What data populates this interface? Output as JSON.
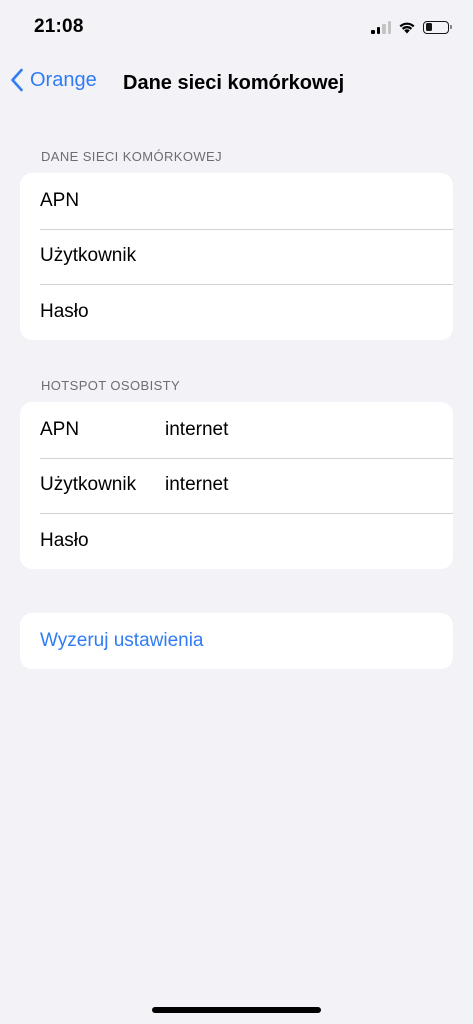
{
  "status_bar": {
    "time": "21:08",
    "icons": [
      "signal-icon",
      "wifi-icon",
      "battery-icon"
    ],
    "battery_level": 0.3
  },
  "nav": {
    "back_label": "Orange",
    "title": "Dane sieci komórkowej"
  },
  "sections": {
    "cellular": {
      "header": "DANE SIECI KOMÓRKOWEJ",
      "rows": [
        {
          "label": "APN",
          "value": ""
        },
        {
          "label": "Użytkownik",
          "value": ""
        },
        {
          "label": "Hasło",
          "value": ""
        }
      ]
    },
    "hotspot": {
      "header": "HOTSPOT OSOBISTY",
      "rows": [
        {
          "label": "APN",
          "value": "internet"
        },
        {
          "label": "Użytkownik",
          "value": "internet"
        },
        {
          "label": "Hasło",
          "value": ""
        }
      ]
    },
    "reset": {
      "label": "Wyzeruj ustawienia"
    }
  },
  "colors": {
    "accent": "#2f7cf6",
    "background": "#f2f2f7",
    "card": "#ffffff",
    "secondary_text": "#6d6d72",
    "separator": "#d1d1d6"
  }
}
